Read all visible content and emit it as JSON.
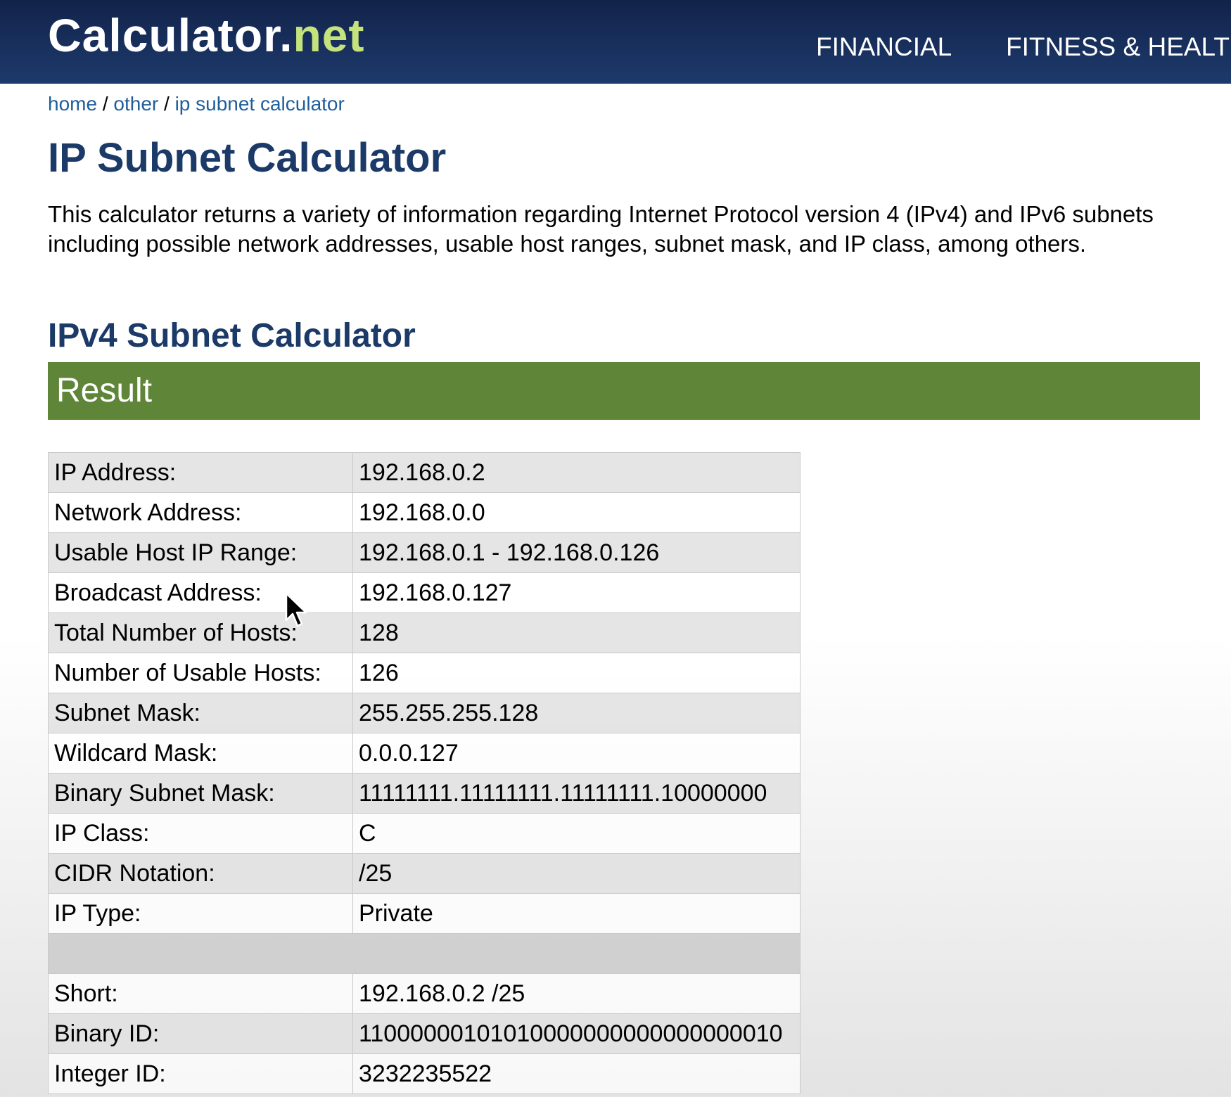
{
  "header": {
    "logo_main": "Calculator.",
    "logo_accent": "net",
    "nav": [
      "FINANCIAL",
      "FITNESS & HEALTH"
    ]
  },
  "breadcrumb": {
    "items": [
      "home",
      "other",
      "ip subnet calculator"
    ],
    "separator": "/"
  },
  "page": {
    "title": "IP Subnet Calculator",
    "description": "This calculator returns a variety of information regarding Internet Protocol version 4 (IPv4) and IPv6 subnets including possible network addresses, usable host ranges, subnet mask, and IP class, among others.",
    "subtitle": "IPv4 Subnet Calculator",
    "result_heading": "Result"
  },
  "results": {
    "rows": [
      {
        "label": "IP Address:",
        "value": "192.168.0.2"
      },
      {
        "label": "Network Address:",
        "value": "192.168.0.0"
      },
      {
        "label": "Usable Host IP Range:",
        "value": "192.168.0.1 - 192.168.0.126"
      },
      {
        "label": "Broadcast Address:",
        "value": "192.168.0.127"
      },
      {
        "label": "Total Number of Hosts:",
        "value": "128"
      },
      {
        "label": "Number of Usable Hosts:",
        "value": "126"
      },
      {
        "label": "Subnet Mask:",
        "value": "255.255.255.128"
      },
      {
        "label": "Wildcard Mask:",
        "value": "0.0.0.127"
      },
      {
        "label": "Binary Subnet Mask:",
        "value": "11111111.11111111.11111111.10000000"
      },
      {
        "label": "IP Class:",
        "value": "C"
      },
      {
        "label": "CIDR Notation:",
        "value": "/25"
      },
      {
        "label": "IP Type:",
        "value": "Private"
      }
    ],
    "rows_after_spacer": [
      {
        "label": "Short:",
        "value": "192.168.0.2 /25"
      },
      {
        "label": "Binary ID:",
        "value": "11000000101010000000000000000010"
      },
      {
        "label": "Integer ID:",
        "value": "3232235522"
      }
    ]
  },
  "colors": {
    "header_bg": "#1b3663",
    "logo_accent": "#c4e37d",
    "heading": "#1b3a68",
    "link": "#1f5e9a",
    "result_bar": "#5e8538"
  },
  "icons": {
    "cursor": "mouse-pointer-icon"
  }
}
